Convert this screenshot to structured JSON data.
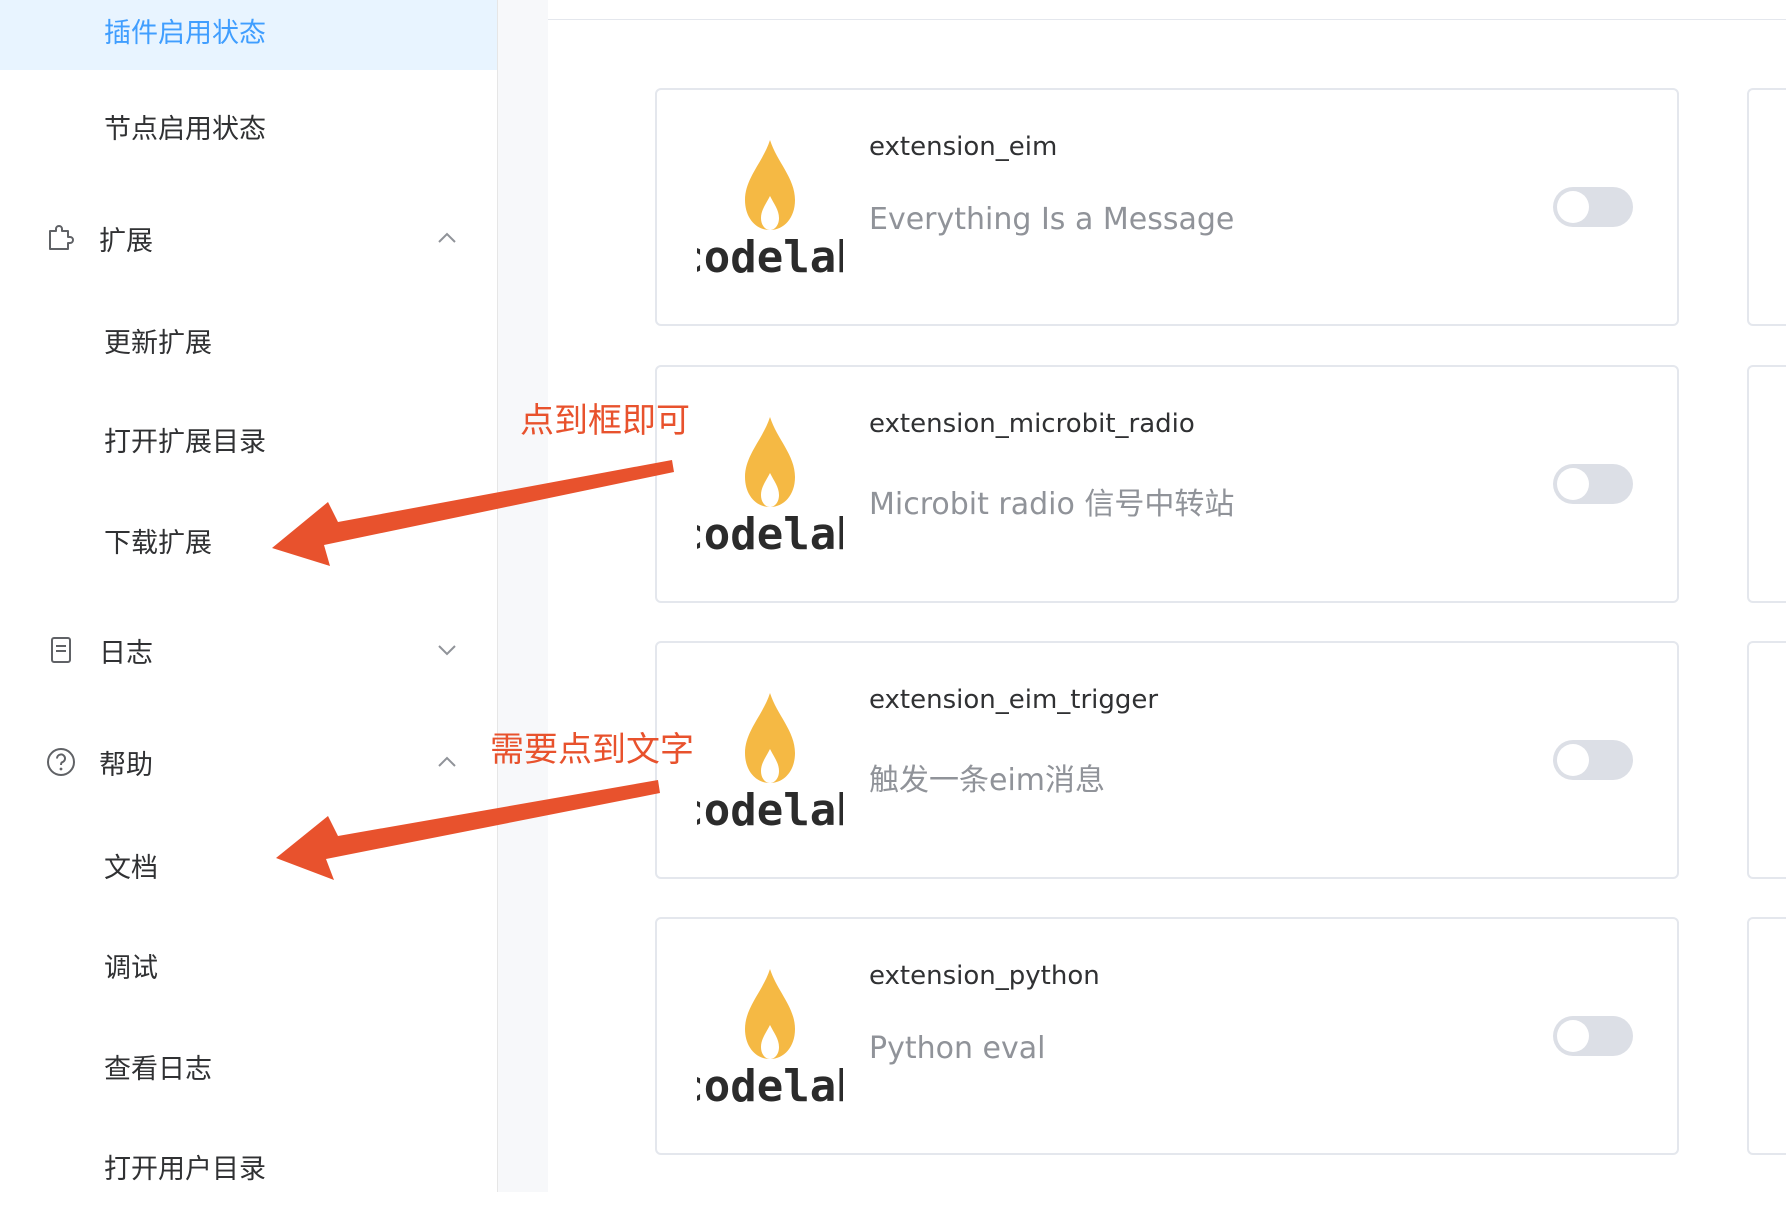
{
  "sidebar": {
    "items": [
      {
        "label": "插件启用状态",
        "type": "sub",
        "active": true
      },
      {
        "label": "节点启用状态",
        "type": "sub"
      },
      {
        "label": "扩展",
        "type": "group",
        "icon": "puzzle-icon",
        "chevron": "up"
      },
      {
        "label": "更新扩展",
        "type": "sub"
      },
      {
        "label": "打开扩展目录",
        "type": "sub"
      },
      {
        "label": "下载扩展",
        "type": "sub"
      },
      {
        "label": "日志",
        "type": "group",
        "icon": "document-icon",
        "chevron": "down"
      },
      {
        "label": "帮助",
        "type": "group",
        "icon": "help-icon",
        "chevron": "up"
      },
      {
        "label": "文档",
        "type": "sub"
      },
      {
        "label": "调试",
        "type": "sub"
      },
      {
        "label": "查看日志",
        "type": "sub"
      },
      {
        "label": "打开用户目录",
        "type": "sub"
      }
    ]
  },
  "extensions": [
    {
      "name": "extension_eim",
      "description": "Everything Is a Message",
      "enabled": false,
      "logo_text": "codelab"
    },
    {
      "name": "extension_microbit_radio",
      "description": "Microbit radio 信号中转站",
      "enabled": false,
      "logo_text": "codelab"
    },
    {
      "name": "extension_eim_trigger",
      "description": "触发一条eim消息",
      "enabled": false,
      "logo_text": "codelab"
    },
    {
      "name": "extension_python",
      "description": "Python eval",
      "enabled": false,
      "logo_text": "codelab"
    }
  ],
  "annotations": {
    "first": "点到框即可",
    "second": "需要点到文字"
  },
  "colors": {
    "accent": "#409eff",
    "active_bg": "#e8f4ff",
    "annotation": "#e8522d",
    "flame_outer": "#f5b944",
    "flame_inner": "#ffffff",
    "toggle_off": "#dcdfe6"
  }
}
